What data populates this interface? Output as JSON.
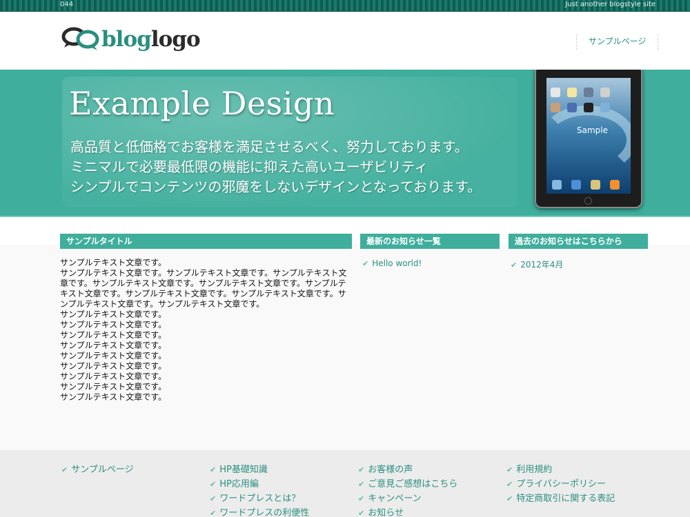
{
  "topbar": {
    "number": "044",
    "tagline": "Just another blogstyle site"
  },
  "header": {
    "logo": {
      "part1": "blog",
      "part2": "logo"
    },
    "nav": [
      {
        "label": "サンプルページ"
      }
    ]
  },
  "hero": {
    "title": "Example Design",
    "lines": [
      "高品質と低価格でお客様を満足させるべく、努力しております。",
      "ミニマルで必要最低限の機能に抑えた高いユーザビリティ",
      "シンプルでコンテンツの邪魔をしないデザインとなっております。"
    ],
    "tablet_label": "Sample"
  },
  "main": {
    "content_title": "サンプルタイトル",
    "paragraph1": "サンプルテキスト文章です。",
    "paragraph2": "サンプルテキスト文章です。サンプルテキスト文章です。サンプルテキスト文章です。サンプルテキスト文章です。サンプルテキスト文章です。サンプルテキスト文章です。サンプルテキスト文章です。サンプルテキスト文章です。サンプルテキスト文章です。サンプルテキスト文章です。",
    "lines": [
      "サンプルテキスト文章です。",
      "サンプルテキスト文章です。",
      "サンプルテキスト文章です。",
      "サンプルテキスト文章です。",
      "サンプルテキスト文章です。",
      "サンプルテキスト文章です。",
      "サンプルテキスト文章です。",
      "サンプルテキスト文章です。",
      "サンプルテキスト文章です。"
    ]
  },
  "widgets": {
    "news": {
      "title": "最新のお知らせ一覧",
      "items": [
        "Hello world!"
      ]
    },
    "archive": {
      "title": "過去のお知らせはこちらから",
      "items": [
        "2012年4月"
      ]
    }
  },
  "footer": {
    "columns": [
      [
        "サンプルページ"
      ],
      [
        "HP基礎知識",
        "HP応用編",
        "ワードプレスとは？",
        "ワードプレスの利便性"
      ],
      [
        "お客様の声",
        "ご意見ご感想はこちら",
        "キャンペーン",
        "お知らせ"
      ],
      [
        "利用規約",
        "プライバシーポリシー",
        "特定商取引に関する表記"
      ]
    ]
  },
  "colors": {
    "accent": "#3fae9c",
    "link": "#2a8f80",
    "topbar": "#0f5c52"
  }
}
